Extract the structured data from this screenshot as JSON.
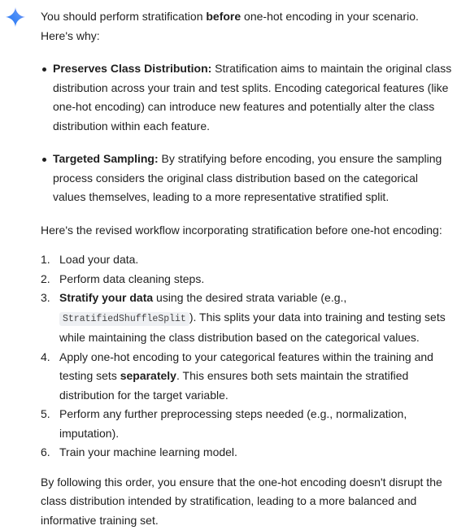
{
  "icons": {
    "assistant": "gemini-sparkle-icon"
  },
  "colors": {
    "text": "#1f1f1f",
    "sparkle_blue": "#4285f4",
    "code_bg": "#eef0f3"
  },
  "response": {
    "intro": {
      "pre": "You should perform stratification ",
      "bold": "before",
      "post": " one-hot encoding in your scenario. Here's why:"
    },
    "bullets": [
      {
        "title": "Preserves Class Distribution:",
        "text": " Stratification aims to maintain the original class distribution across your train and test splits. Encoding categorical features (like one-hot encoding) can introduce new features and potentially alter the class distribution within each feature."
      },
      {
        "title": "Targeted Sampling:",
        "text": " By stratifying before encoding, you ensure the sampling process considers the original class distribution based on the categorical values themselves, leading to a more representative stratified split."
      }
    ],
    "workflow_intro": "Here's the revised workflow incorporating stratification before one-hot encoding:",
    "steps": [
      {
        "num": "1.",
        "text": "Load your data."
      },
      {
        "num": "2.",
        "text": "Perform data cleaning steps."
      },
      {
        "num": "3.",
        "bold": "Stratify your data",
        "pre": " using the desired strata variable (e.g., ",
        "code": "StratifiedShuffleSplit",
        "post": "). This splits your data into training and testing sets while maintaining the class distribution based on the categorical values."
      },
      {
        "num": "4.",
        "pre": "Apply one-hot encoding to your categorical features within the training and testing sets ",
        "bold": "separately",
        "post": ". This ensures both sets maintain the stratified distribution for the target variable."
      },
      {
        "num": "5.",
        "text": "Perform any further preprocessing steps needed (e.g., normalization, imputation)."
      },
      {
        "num": "6.",
        "text": "Train your machine learning model."
      }
    ],
    "conclusion": "By following this order, you ensure that the one-hot encoding doesn't disrupt the class distribution intended by stratification, leading to a more balanced and informative training set."
  }
}
